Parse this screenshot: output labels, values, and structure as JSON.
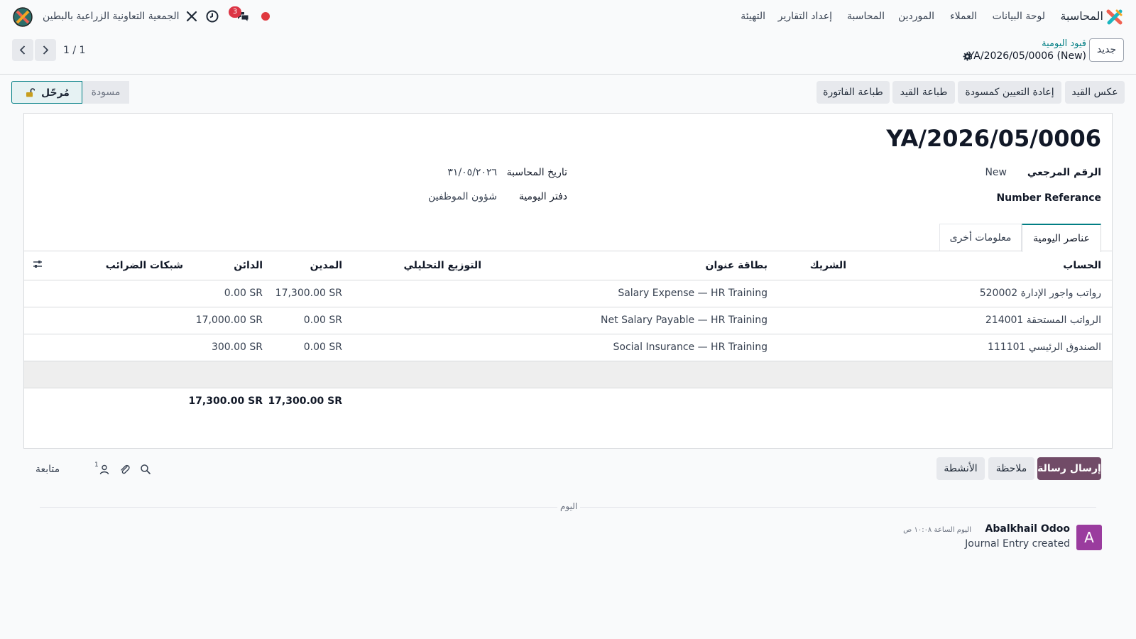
{
  "colors": {
    "brand": "#017e84",
    "primary": "#714b67",
    "danger": "#dc3545",
    "avatar": "#9a3c9e"
  },
  "navbar": {
    "app_name": "المحاسبة",
    "menu": [
      "لوحة البيانات",
      "العملاء",
      "الموردين",
      "المحاسبة",
      "إعداد التقارير",
      "التهيئة"
    ],
    "company": "الجمعية التعاونية الزراعية بالبطين",
    "messages_badge": "3",
    "icons": [
      "apps-icon",
      "chat-icon",
      "clock-icon",
      "tools-icon",
      "record-dot",
      "avatar-icon"
    ]
  },
  "control_panel": {
    "new_label": "جديد",
    "breadcrumb_parent": "قيود اليومية",
    "breadcrumb_current": "YA/2026/05/0006 (New)",
    "pager": "1 / 1"
  },
  "actions": {
    "reverse": "عكس القيد",
    "reset_draft": "إعادة التعيين كمسودة",
    "print_entry": "طباعة القيد",
    "print_invoice": "طباعة الفاتورة"
  },
  "statusbar": {
    "draft": "مسودة",
    "posted": "مُرحّل"
  },
  "form": {
    "title": "YA/2026/05/0006",
    "ref_label": "الرقم المرجعي",
    "ref_value": "New",
    "number_ref_label": "Number Referance",
    "date_label": "تاريخ المحاسبة",
    "date_value": "٣١/٠٥/٢٠٢٦",
    "journal_label": "دفتر اليومية",
    "journal_value": "شؤون الموظفين"
  },
  "tabs": {
    "items": "عناصر اليومية",
    "other": "معلومات أخرى"
  },
  "table": {
    "headers": {
      "account": "الحساب",
      "partner": "الشريك",
      "label": "بطاقة عنوان",
      "analytic": "التوزيع التحليلي",
      "debit": "المدين",
      "credit": "الدائن",
      "tax_grids": "شبكات الضرائب"
    },
    "rows": [
      {
        "account": "520002 رواتب واجور الإدارة",
        "partner": "",
        "label": "Salary Expense — HR Training",
        "debit": "17,300.00 SR",
        "credit": "0.00 SR"
      },
      {
        "account": "214001 الرواتب المستحقة",
        "partner": "",
        "label": "Net Salary Payable — HR Training",
        "debit": "0.00 SR",
        "credit": "17,000.00 SR"
      },
      {
        "account": "111101 الصندوق الرئيسي",
        "partner": "",
        "label": "Social Insurance — HR Training",
        "debit": "0.00 SR",
        "credit": "300.00 SR"
      }
    ],
    "totals": {
      "debit": "17,300.00 SR",
      "credit": "17,300.00 SR"
    }
  },
  "chatter": {
    "send_message": "إرسال رسالة",
    "log_note": "ملاحظة",
    "activities": "الأنشطة",
    "follow": "متابعة",
    "followers_count": "1",
    "today": "اليوم",
    "message": {
      "avatar_letter": "A",
      "author": "Abalkhail Odoo",
      "time": "اليوم الساعة ١٠:٠٨ ص",
      "body": "Journal Entry created"
    }
  }
}
